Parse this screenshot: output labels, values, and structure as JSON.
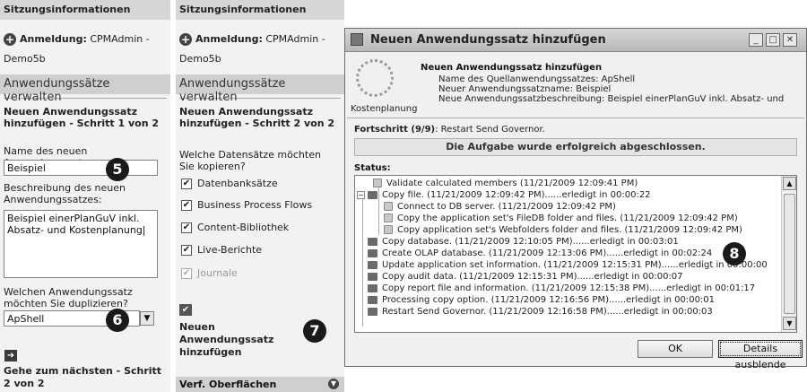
{
  "panel1": {
    "section_title": "Sitzungsinformationen",
    "login_label": "Anmeldung:",
    "login_user": "CPMAdmin -",
    "login_host": "Demo5b",
    "manage_title": "Anwendungssätze verwalten",
    "step_title": "Neuen Anwendungssatz hinzufügen - Schritt 1 von 2",
    "name_label": "Name des neuen Anwendungssatzes:",
    "name_value": "Beispiel",
    "desc_label": "Beschreibung des neuen Anwendungssatzes:",
    "desc_value": "Beispiel einerPlanGuV inkl. Absatz- und Kostenplanung|",
    "dup_label": "Welchen Anwendungssatz möchten Sie duplizieren?",
    "dup_value": "ApShell",
    "next_label": "Gehe zum nächsten - Schritt 2 von 2"
  },
  "panel2": {
    "section_title": "Sitzungsinformationen",
    "login_label": "Anmeldung:",
    "login_user": "CPMAdmin -",
    "login_host": "Demo5b",
    "manage_title": "Anwendungssätze verwalten",
    "step_title": "Neuen Anwendungssatz hinzufügen - Schritt 2 von 2",
    "question": "Welche Datensätze möchten Sie kopieren?",
    "checkboxes": [
      {
        "label": "Datenbanksätze",
        "checked": true,
        "enabled": true
      },
      {
        "label": "Business Process Flows",
        "checked": true,
        "enabled": true
      },
      {
        "label": "Content-Bibliothek",
        "checked": true,
        "enabled": true
      },
      {
        "label": "Live-Berichte",
        "checked": true,
        "enabled": true
      },
      {
        "label": "Journale",
        "checked": true,
        "enabled": false
      }
    ],
    "add_label": "Neuen Anwendungssatz hinzufügen",
    "footer_label": "Verf. Oberflächen"
  },
  "badges": [
    "5",
    "6",
    "7",
    "8"
  ],
  "dialog": {
    "title": "Neuen Anwendungssatz hinzufügen",
    "info_head": "Neuen Anwendungssatz hinzufügen",
    "info_lines": [
      "Name des Quellanwendungssatzes: ApShell",
      "Neuer Anwendungssatzname: Beispiel",
      "Neue Anwendungssatzbeschreibung: Beispiel einerPlanGuV inkl. Absatz- und",
      "Kostenplanung"
    ],
    "progress_label": "Fortschritt (9/9)",
    "progress_text": ": Restart Send Governor.",
    "done_text": "Die Aufgabe wurde erfolgreich abgeschlossen.",
    "status_label": "Status:",
    "status_rows": [
      "Validate calculated members  (11/21/2009 12:09:41 PM)",
      "Copy file.  (11/21/2009 12:09:42 PM)......erledigt in 00:00:22",
      "Connect to DB server.  (11/21/2009 12:09:42 PM)",
      "Copy the application set's FileDB folder and files.   (11/21/2009 12:09:42 PM)",
      "Copy application set's Webfolders folder and files.   (11/21/2009 12:09:42 PM)",
      "Copy database.  (11/21/2009 12:10:05 PM)......erledigt in 00:03:01",
      "Create OLAP database.  (11/21/2009 12:13:06 PM)......erledigt in 00:02:24",
      "Update application set information.   (11/21/2009 12:15:31 PM)......erledigt in 00:00:00",
      "Copy audit data.  (11/21/2009 12:15:31 PM)......erledigt in 00:00:07",
      "Copy report file and information.   (11/21/2009 12:15:38 PM)......erledigt in 00:01:17",
      "Processing copy option.   (11/21/2009 12:16:56 PM)......erledigt in 00:00:01",
      "Restart Send Governor.   (11/21/2009 12:16:58 PM)......erledigt in 00:00:03"
    ],
    "ok_label": "OK",
    "details_label": "Details ausblende"
  }
}
